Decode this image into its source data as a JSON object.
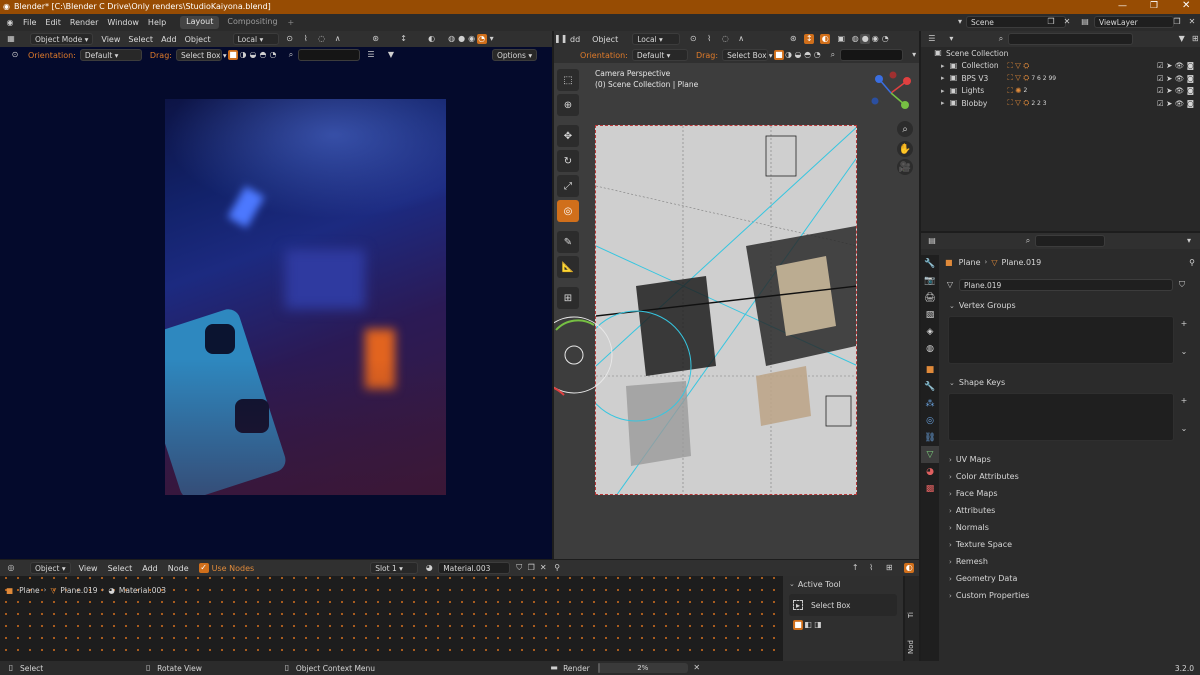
{
  "titlebar": {
    "title": "Blender* [C:\\Blender C Drive\\Only renders\\StudioKaiyona.blend]"
  },
  "menu": {
    "items": [
      "File",
      "Edit",
      "Render",
      "Window",
      "Help"
    ]
  },
  "workspaces": [
    {
      "label": "Layout",
      "active": true
    },
    {
      "label": "Compositing",
      "active": false
    }
  ],
  "scene": {
    "name": "Scene",
    "viewlayer": "ViewLayer"
  },
  "left_viewport": {
    "mode": "Object Mode",
    "menus": [
      "View",
      "Select",
      "Add",
      "Object"
    ],
    "transform": "Local",
    "orientation_label": "Orientation:",
    "orientation": "Default",
    "drag_label": "Drag:",
    "drag": "Select Box",
    "options": "Options"
  },
  "right_viewport": {
    "transform": "Local",
    "orientation_label": "Orientation:",
    "orientation": "Default",
    "drag_label": "Drag:",
    "drag": "Select Box",
    "menus": [
      "Object"
    ],
    "glyph": "dd",
    "overlay_line1": "Camera Perspective",
    "overlay_line2": "(0) Scene Collection | Plane"
  },
  "outliner": {
    "header": "Scene Collection",
    "rows": [
      {
        "label": "Collection",
        "counts": "",
        "indent": 1
      },
      {
        "label": "BPS V3",
        "counts": "7  6  2  99",
        "indent": 1
      },
      {
        "label": "Lights",
        "counts": "2",
        "indent": 1
      },
      {
        "label": "Blobby",
        "counts": "2  2  3",
        "indent": 1
      }
    ]
  },
  "properties": {
    "breadcrumb": [
      "Plane",
      "Plane.019"
    ],
    "mesh_name": "Plane.019",
    "sections_open": [
      "Vertex Groups",
      "Shape Keys"
    ],
    "sections_closed": [
      "UV Maps",
      "Color Attributes",
      "Face Maps",
      "Attributes",
      "Normals",
      "Texture Space",
      "Remesh",
      "Geometry Data",
      "Custom Properties"
    ]
  },
  "node_editor": {
    "type": "Object",
    "menus": [
      "View",
      "Select",
      "Add",
      "Node"
    ],
    "use_nodes": "Use Nodes",
    "slot": "Slot 1",
    "material": "Material.003",
    "breadcrumb": [
      "Plane",
      "Plane.019",
      "Material.003"
    ]
  },
  "active_tool": {
    "title": "Active Tool",
    "tool": "Select Box",
    "side_tabs": [
      "Nod",
      "Ti"
    ]
  },
  "statusbar": {
    "select": "Select",
    "rotate": "Rotate View",
    "context": "Object Context Menu",
    "render": "Render",
    "progress": "2%",
    "version": "3.2.0"
  },
  "colors": {
    "accent": "#d06f1b",
    "title_bar": "#974c03",
    "viewport_bg": "#3d3d3d",
    "render_bg": "#040a2c"
  }
}
